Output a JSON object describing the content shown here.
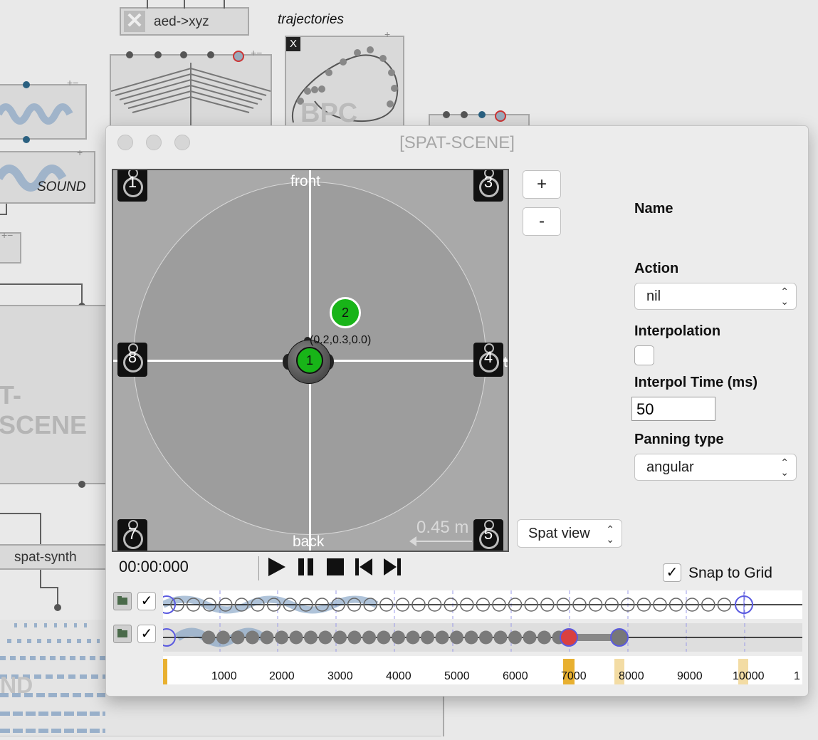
{
  "background": {
    "aed_label": "aed->xyz",
    "trajectories_label": "trajectories",
    "bpc_label": "BPC",
    "sound_label": "SOUND",
    "spat_scene_bg_label": "T-SCENE",
    "spat_synth_label": "spat-synth",
    "nd_label": "ND",
    "x_label": "X"
  },
  "window": {
    "title": "[SPAT-SCENE]"
  },
  "view": {
    "front_label": "front",
    "back_label": "back",
    "source_coords": "(0.2,0.3,0.0)",
    "scale_label": "0.45 m",
    "side_label": "t",
    "speakers": [
      "1",
      "3",
      "8",
      "4",
      "7",
      "5"
    ],
    "sources": [
      "1",
      "2"
    ]
  },
  "zoom": {
    "plus": "+",
    "minus": "-"
  },
  "props": {
    "name_label": "Name",
    "action_label": "Action",
    "action_value": "nil",
    "interp_label": "Interpolation",
    "interp_checked": false,
    "interp_time_label": "Interpol Time (ms)",
    "interp_time_value": "50",
    "panning_label": "Panning type",
    "panning_value": "angular"
  },
  "spat_view": "Spat view",
  "transport": {
    "time": "00:00:000",
    "play_icon": "play-icon",
    "pause_icon": "pause-icon",
    "stop_icon": "stop-icon",
    "prev_icon": "prev-icon",
    "next_icon": "next-icon"
  },
  "snap_label": "Snap to Grid",
  "snap_checked": true,
  "tracks": [
    {
      "checked": true
    },
    {
      "checked": true
    }
  ],
  "ruler": [
    "1000",
    "2000",
    "3000",
    "4000",
    "5000",
    "6000",
    "7000",
    "8000",
    "9000",
    "10000",
    "1"
  ],
  "colors": {
    "source_green": "#18b418",
    "selected_red": "#d94040",
    "marker_blue": "#5a5ae0",
    "marker_gold": "#e8b030"
  }
}
